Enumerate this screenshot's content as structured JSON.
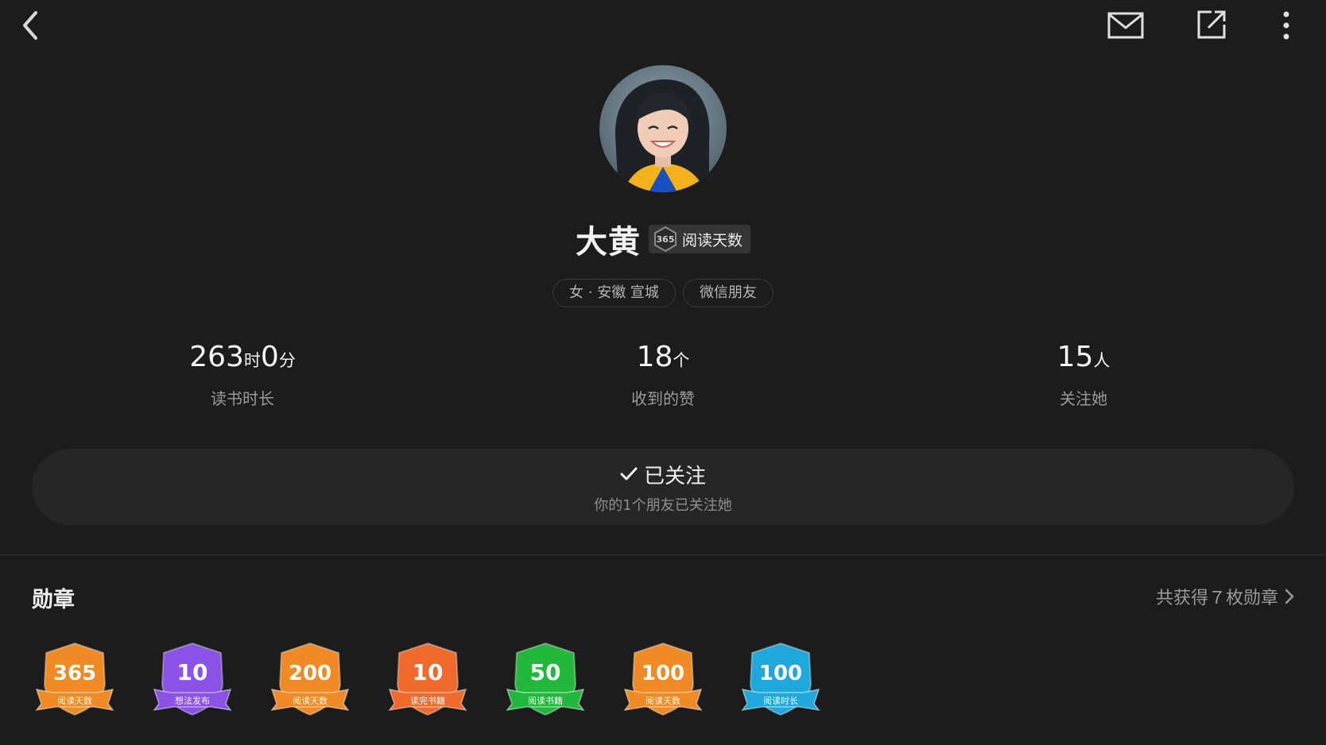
{
  "profile": {
    "name": "大黄",
    "title_badge": {
      "number": "365",
      "label": "阅读天数"
    },
    "tags": [
      "女 · 安徽 宣城",
      "微信朋友"
    ]
  },
  "stats": [
    {
      "value": "263",
      "unit": "时",
      "value2": "0",
      "unit2": "分",
      "label": "读书时长"
    },
    {
      "value": "18",
      "unit": "个",
      "label": "收到的赞"
    },
    {
      "value": "15",
      "unit": "人",
      "label": "关注她"
    }
  ],
  "follow": {
    "status": "已关注",
    "subtitle": "你的1个朋友已关注她"
  },
  "medals": {
    "title": "勋章",
    "summary": "共获得７枚勋章",
    "items": [
      {
        "number": "365",
        "label": "阅读天数",
        "color": "#f08a24"
      },
      {
        "number": "10",
        "label": "想法发布",
        "color": "#8a52e6"
      },
      {
        "number": "200",
        "label": "阅读天数",
        "color": "#f08a24"
      },
      {
        "number": "10",
        "label": "读完书籍",
        "color": "#f06a2c"
      },
      {
        "number": "50",
        "label": "阅读书籍",
        "color": "#22b83c"
      },
      {
        "number": "100",
        "label": "阅读天数",
        "color": "#f08a24"
      },
      {
        "number": "100",
        "label": "阅读时长",
        "color": "#1ea8dc"
      }
    ]
  }
}
